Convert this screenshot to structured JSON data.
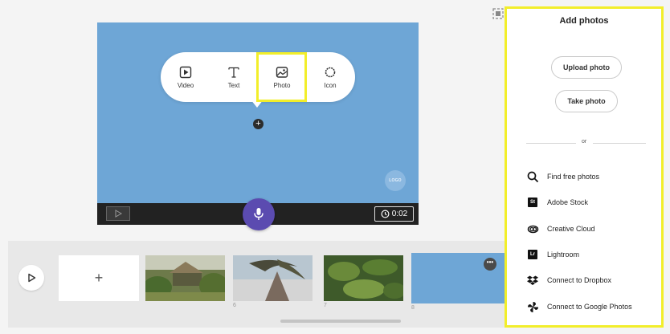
{
  "stage": {
    "logo_text": "LOGO",
    "popup": {
      "items": [
        {
          "label": "Video",
          "icon": "video-icon"
        },
        {
          "label": "Text",
          "icon": "text-icon"
        },
        {
          "label": "Photo",
          "icon": "photo-icon"
        },
        {
          "label": "Icon",
          "icon": "icon-icon"
        }
      ],
      "add_symbol": "+"
    },
    "timer": "0:02",
    "mic_icon": "microphone-icon"
  },
  "timeline": {
    "add_symbol": "+",
    "thumbs": [
      {
        "number": ""
      },
      {
        "number": "6"
      },
      {
        "number": "7"
      },
      {
        "number": "8"
      }
    ],
    "more_symbol": "•••"
  },
  "panel": {
    "title": "Add photos",
    "upload_label": "Upload photo",
    "take_label": "Take photo",
    "or_label": "or",
    "services": [
      {
        "label": "Find free photos",
        "icon": "search-icon"
      },
      {
        "label": "Adobe Stock",
        "icon": "adobe-stock-icon",
        "badge": "St"
      },
      {
        "label": "Creative Cloud",
        "icon": "creative-cloud-icon"
      },
      {
        "label": "Lightroom",
        "icon": "lightroom-icon",
        "badge": "Lr"
      },
      {
        "label": "Connect to Dropbox",
        "icon": "dropbox-icon"
      },
      {
        "label": "Connect to Google Photos",
        "icon": "google-photos-icon"
      }
    ]
  },
  "colors": {
    "stage_blue": "#6ea6d6",
    "highlight_yellow": "#f2ee2a",
    "mic_purple": "#5b4bb0"
  }
}
